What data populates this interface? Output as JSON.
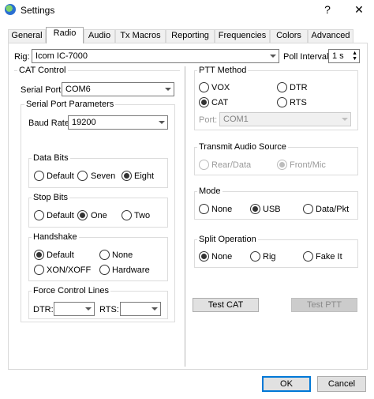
{
  "window": {
    "title": "Settings",
    "help_glyph": "?",
    "close_glyph": "✕"
  },
  "tabs": [
    "General",
    "Radio",
    "Audio",
    "Tx Macros",
    "Reporting",
    "Frequencies",
    "Colors",
    "Advanced"
  ],
  "rig": {
    "label": "Rig:",
    "value": "Icom IC-7000",
    "poll_label": "Poll Interval:",
    "poll_value": "1 s"
  },
  "cat": {
    "title": "CAT Control",
    "serial_port_label": "Serial Port:",
    "serial_port_value": "COM6",
    "params_title": "Serial Port Parameters",
    "baud_label": "Baud Rate:",
    "baud_value": "19200",
    "data_bits": {
      "title": "Data Bits",
      "options": [
        "Default",
        "Seven",
        "Eight"
      ]
    },
    "stop_bits": {
      "title": "Stop Bits",
      "options": [
        "Default",
        "One",
        "Two"
      ]
    },
    "handshake": {
      "title": "Handshake",
      "options": [
        "Default",
        "None",
        "XON/XOFF",
        "Hardware"
      ]
    },
    "force": {
      "title": "Force Control Lines",
      "dtr_label": "DTR:",
      "rts_label": "RTS:"
    }
  },
  "ptt": {
    "title": "PTT Method",
    "options": [
      "VOX",
      "DTR",
      "CAT",
      "RTS"
    ],
    "port_label": "Port:",
    "port_value": "COM1"
  },
  "tx_audio": {
    "title": "Transmit Audio Source",
    "options": [
      "Rear/Data",
      "Front/Mic"
    ]
  },
  "mode": {
    "title": "Mode",
    "options": [
      "None",
      "USB",
      "Data/Pkt"
    ]
  },
  "split": {
    "title": "Split Operation",
    "options": [
      "None",
      "Rig",
      "Fake It"
    ]
  },
  "buttons": {
    "test_cat": "Test CAT",
    "test_ptt": "Test PTT",
    "ok": "OK",
    "cancel": "Cancel"
  }
}
